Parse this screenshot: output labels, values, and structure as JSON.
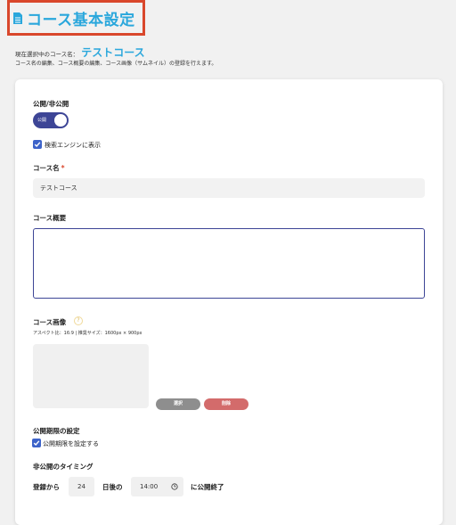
{
  "header": {
    "title": "コース基本設定",
    "current_label": "現在選択中のコース名：",
    "current_course": "テストコース",
    "description": "コース名の編集、コース概要の編集、コース画像（サムネイル）の登録を行えます。"
  },
  "form": {
    "visibility": {
      "label": "公開/非公開",
      "toggle_text": "公開",
      "on": true
    },
    "search_engine": {
      "label": "検索エンジンに表示",
      "checked": true
    },
    "course_name": {
      "label": "コース名",
      "required_mark": "*",
      "value": "テストコース"
    },
    "course_summary": {
      "label": "コース概要",
      "value": ""
    },
    "course_image": {
      "label": "コース画像",
      "help_icon": "?",
      "hint": "アスペクト比：16:9 | 推奨サイズ：1600px × 900px",
      "select_label": "選択",
      "delete_label": "削除"
    },
    "publish_period": {
      "section_label": "公開期限の設定",
      "checkbox_label": "公開期限を設定する",
      "checked": true,
      "timing_label": "非公開のタイミング",
      "from_label": "登録から",
      "days_value": "24",
      "days_after_label": "日後の",
      "time_value": "14:00",
      "end_label": "に公開終了"
    }
  },
  "icons": {
    "title_icon": "document-icon",
    "help_icon": "help-icon",
    "clock_icon": "clock-icon",
    "check_icon": "check-icon"
  },
  "colors": {
    "accent_blue": "#2aa7dc",
    "toggle_navy": "#3d4596",
    "checkbox_blue": "#3d63c9",
    "highlight_red": "#d9472c",
    "delete_red": "#d36b6b",
    "select_gray": "#8e8e8e"
  }
}
